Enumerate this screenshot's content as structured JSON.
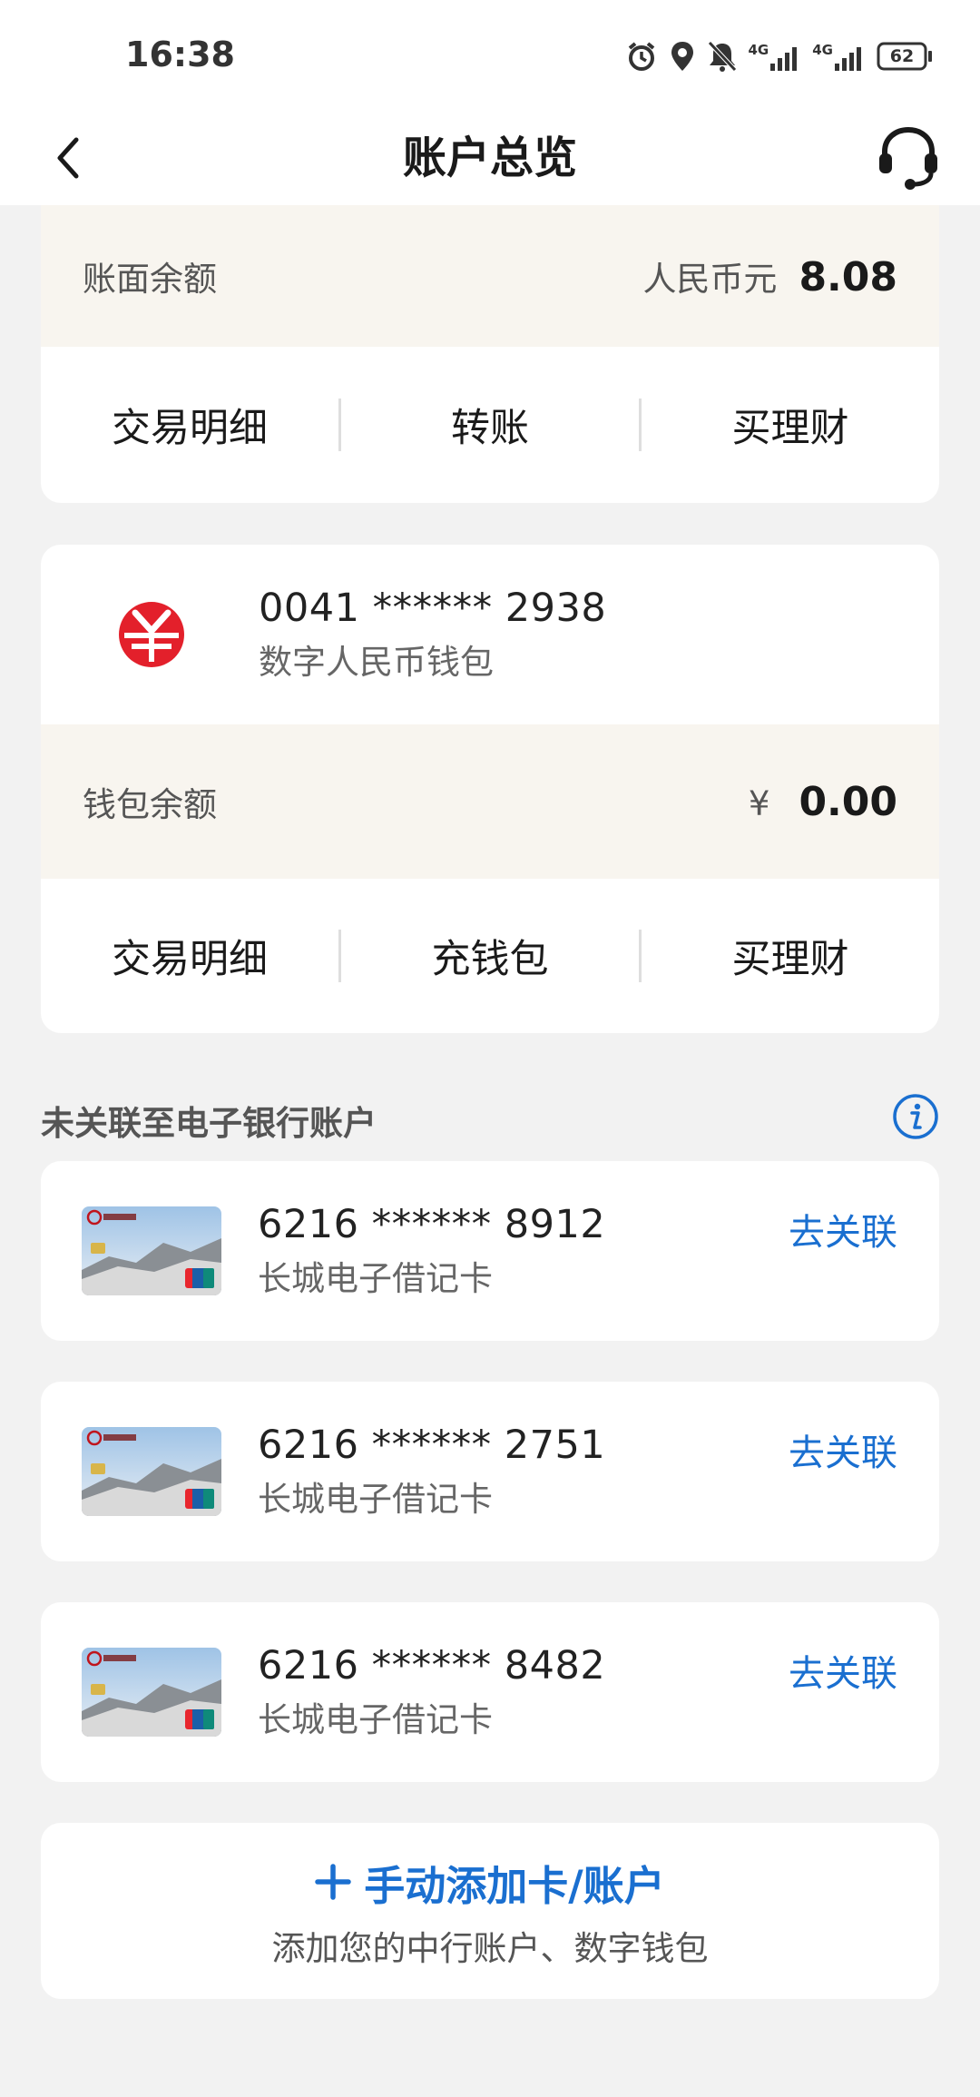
{
  "status_bar": {
    "time": "16:38",
    "network_1": "4G",
    "network_2": "4G",
    "battery": "62",
    "icons": [
      "alarm-icon",
      "location-icon",
      "mute-icon",
      "signal-icon",
      "signal-icon",
      "battery-icon"
    ]
  },
  "nav": {
    "title": "账户总览",
    "back_icon": "chevron-left-icon",
    "service_icon": "headset-icon"
  },
  "account_card": {
    "balance_label": "账面余额",
    "currency": "人民币元",
    "balance": "8.08",
    "actions": [
      "交易明细",
      "转账",
      "买理财"
    ]
  },
  "wallet_card": {
    "number": "0041 ****** 2938",
    "name": "数字人民币钱包",
    "balance_label": "钱包余额",
    "currency_symbol": "¥",
    "balance": "0.00",
    "actions": [
      "交易明细",
      "充钱包",
      "买理财"
    ]
  },
  "unlinked_section": {
    "title": "未关联至电子银行账户",
    "info_icon": "info-icon",
    "cards": [
      {
        "number": "6216 ****** 8912",
        "name": "长城电子借记卡",
        "action": "去关联"
      },
      {
        "number": "6216 ****** 2751",
        "name": "长城电子借记卡",
        "action": "去关联"
      },
      {
        "number": "6216 ****** 8482",
        "name": "长城电子借记卡",
        "action": "去关联"
      }
    ]
  },
  "add_account": {
    "title": "手动添加卡/账户",
    "subtitle": "添加您的中行账户、数字钱包"
  },
  "colors": {
    "accent": "#1a6fd0",
    "wallet_red": "#e3202b",
    "balance_bg": "#f8f5ef",
    "page_bg": "#f2f2f2"
  }
}
